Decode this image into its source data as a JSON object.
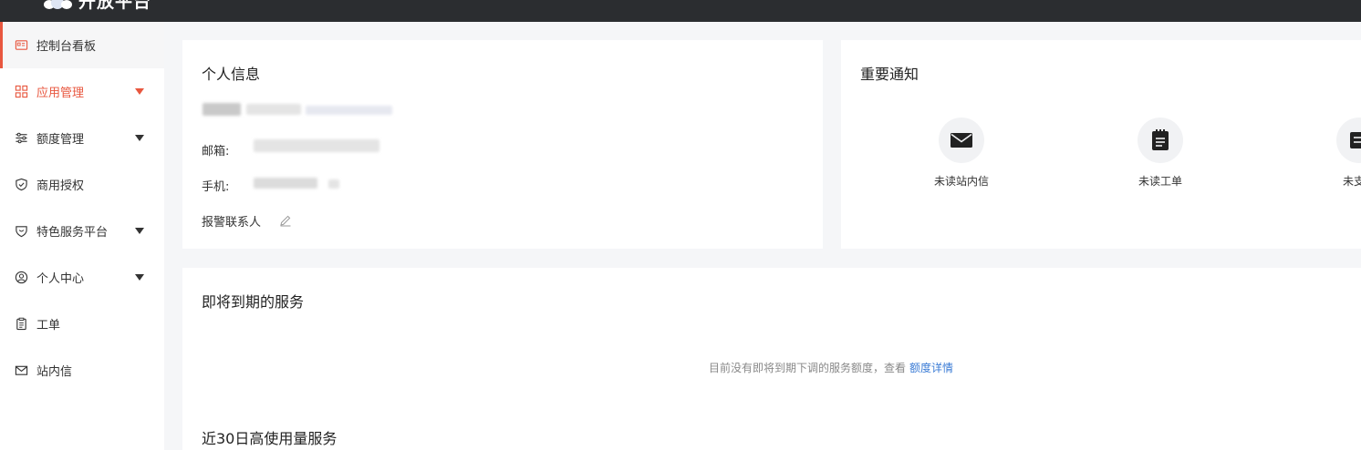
{
  "app": {
    "logo_text": "开放平台"
  },
  "sidebar": {
    "items": [
      {
        "label": "控制台看板",
        "icon": "dashboard-icon",
        "active": true,
        "has_caret": false
      },
      {
        "label": "应用管理",
        "icon": "grid-icon",
        "open": true,
        "has_caret": true
      },
      {
        "label": "额度管理",
        "icon": "sliders-icon",
        "has_caret": true
      },
      {
        "label": "商用授权",
        "icon": "shield-check-icon",
        "has_caret": false
      },
      {
        "label": "特色服务平台",
        "icon": "heart-shield-icon",
        "has_caret": true
      },
      {
        "label": "个人中心",
        "icon": "user-circle-icon",
        "has_caret": true
      },
      {
        "label": "工单",
        "icon": "clipboard-icon",
        "has_caret": false
      },
      {
        "label": "站内信",
        "icon": "mail-icon",
        "has_caret": false
      }
    ]
  },
  "personal_info": {
    "title": "个人信息",
    "email_label": "邮箱:",
    "phone_label": "手机:",
    "alarm_contact_label": "报警联系人"
  },
  "notices": {
    "title": "重要通知",
    "items": [
      {
        "label": "未读站内信",
        "icon": "envelope-icon"
      },
      {
        "label": "未读工单",
        "icon": "notepad-icon"
      },
      {
        "label": "未支付",
        "icon": "bill-icon"
      }
    ]
  },
  "expiring": {
    "title": "即将到期的服务",
    "empty_text": "目前没有即将到期下调的服务额度，查看",
    "link_text": "额度详情"
  },
  "high_usage": {
    "title": "近30日高使用量服务"
  },
  "colors": {
    "accent": "#e8573f",
    "link": "#3a7bd5",
    "topbar": "#2b2d30"
  }
}
